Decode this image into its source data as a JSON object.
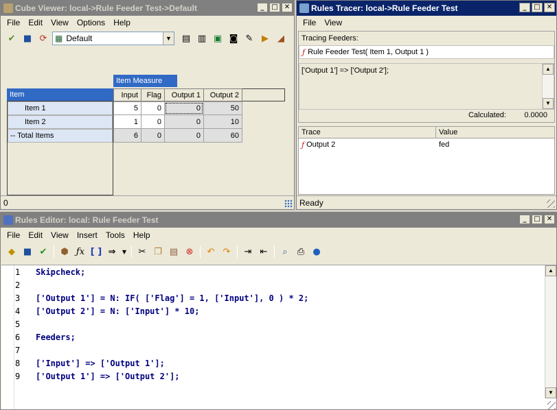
{
  "cube_viewer": {
    "title": "Cube Viewer: local->Rule Feeder Test->Default",
    "menu": [
      "File",
      "Edit",
      "View",
      "Options",
      "Help"
    ],
    "view_select": "Default",
    "column_dim_label": "Item Measure",
    "row_dim_label": "Item",
    "columns": [
      "Input",
      "Flag",
      "Output 1",
      "Output 2"
    ],
    "rows": [
      {
        "label": "Item 1",
        "values": [
          "5",
          "0",
          "0",
          "50"
        ]
      },
      {
        "label": "Item 2",
        "values": [
          "1",
          "0",
          "0",
          "10"
        ]
      },
      {
        "label": "-- Total Items",
        "values": [
          "6",
          "0",
          "0",
          "60"
        ]
      }
    ],
    "status": "0"
  },
  "rules_tracer": {
    "title": "Rules Tracer: local->Rule Feeder Test",
    "menu": [
      "File",
      "View"
    ],
    "tracing_label": "Tracing Feeders:",
    "tracing_item": "Rule Feeder Test( Item 1, Output 1 )",
    "expression": "['Output 1'] => ['Output 2'];",
    "calculated_label": "Calculated:",
    "calculated_value": "0.0000",
    "trace_headers": [
      "Trace",
      "Value"
    ],
    "trace_rows": [
      {
        "trace": "Output 2",
        "value": "fed"
      }
    ],
    "status": "Ready"
  },
  "rules_editor": {
    "title": "Rules Editor: local: Rule Feeder Test",
    "menu": [
      "File",
      "Edit",
      "View",
      "Insert",
      "Tools",
      "Help"
    ],
    "lines": [
      {
        "n": "1",
        "code": "Skipcheck;"
      },
      {
        "n": "2",
        "code": ""
      },
      {
        "n": "3",
        "code": "['Output 1'] = N: IF( ['Flag'] = 1, ['Input'], 0 ) * 2;"
      },
      {
        "n": "4",
        "code": "['Output 2'] = N: ['Input'] * 10;"
      },
      {
        "n": "5",
        "code": ""
      },
      {
        "n": "6",
        "code": "Feeders;"
      },
      {
        "n": "7",
        "code": ""
      },
      {
        "n": "8",
        "code": "['Input'] => ['Output 1'];"
      },
      {
        "n": "9",
        "code": "['Output 1'] => ['Output 2'];"
      }
    ]
  }
}
